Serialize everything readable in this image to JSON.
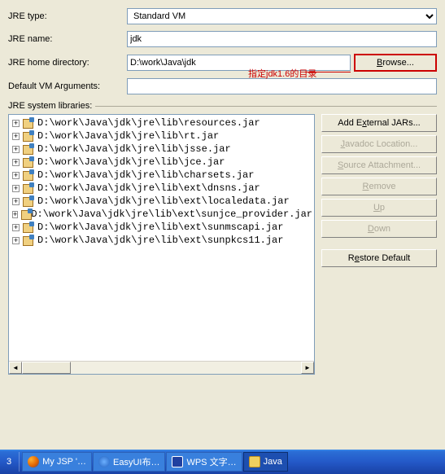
{
  "labels": {
    "jre_type": "JRE type:",
    "jre_name": "JRE name:",
    "jre_home": "JRE home directory:",
    "default_args": "Default VM Arguments:",
    "sys_libs": "JRE system libraries:"
  },
  "fields": {
    "jre_type": "Standard VM",
    "jre_name": "jdk",
    "jre_home": "D:\\work\\Java\\jdk",
    "default_args": ""
  },
  "annotation": "指定jdk1.6的目录",
  "buttons": {
    "browse": "Browse...",
    "add_external": "Add External JARs...",
    "javadoc": "Javadoc Location...",
    "source": "Source Attachment...",
    "remove": "Remove",
    "up": "Up",
    "down": "Down",
    "restore": "Restore Default"
  },
  "underline": {
    "browse": "B",
    "add_external": "x",
    "javadoc": "J",
    "source": "S",
    "remove": "R",
    "up": "U",
    "down": "D",
    "restore": "e"
  },
  "jars": [
    "D:\\work\\Java\\jdk\\jre\\lib\\resources.jar",
    "D:\\work\\Java\\jdk\\jre\\lib\\rt.jar",
    "D:\\work\\Java\\jdk\\jre\\lib\\jsse.jar",
    "D:\\work\\Java\\jdk\\jre\\lib\\jce.jar",
    "D:\\work\\Java\\jdk\\jre\\lib\\charsets.jar",
    "D:\\work\\Java\\jdk\\jre\\lib\\ext\\dnsns.jar",
    "D:\\work\\Java\\jdk\\jre\\lib\\ext\\localedata.jar",
    "D:\\work\\Java\\jdk\\jre\\lib\\ext\\sunjce_provider.jar",
    "D:\\work\\Java\\jdk\\jre\\lib\\ext\\sunmscapi.jar",
    "D:\\work\\Java\\jdk\\jre\\lib\\ext\\sunpkcs11.jar"
  ],
  "taskbar": {
    "num": "3",
    "items": [
      {
        "label": "My JSP '…",
        "icon": "ff"
      },
      {
        "label": "EasyUI布…",
        "icon": "ie"
      },
      {
        "label": "WPS 文字…",
        "icon": "wps"
      },
      {
        "label": "Java",
        "icon": "folder"
      }
    ]
  }
}
